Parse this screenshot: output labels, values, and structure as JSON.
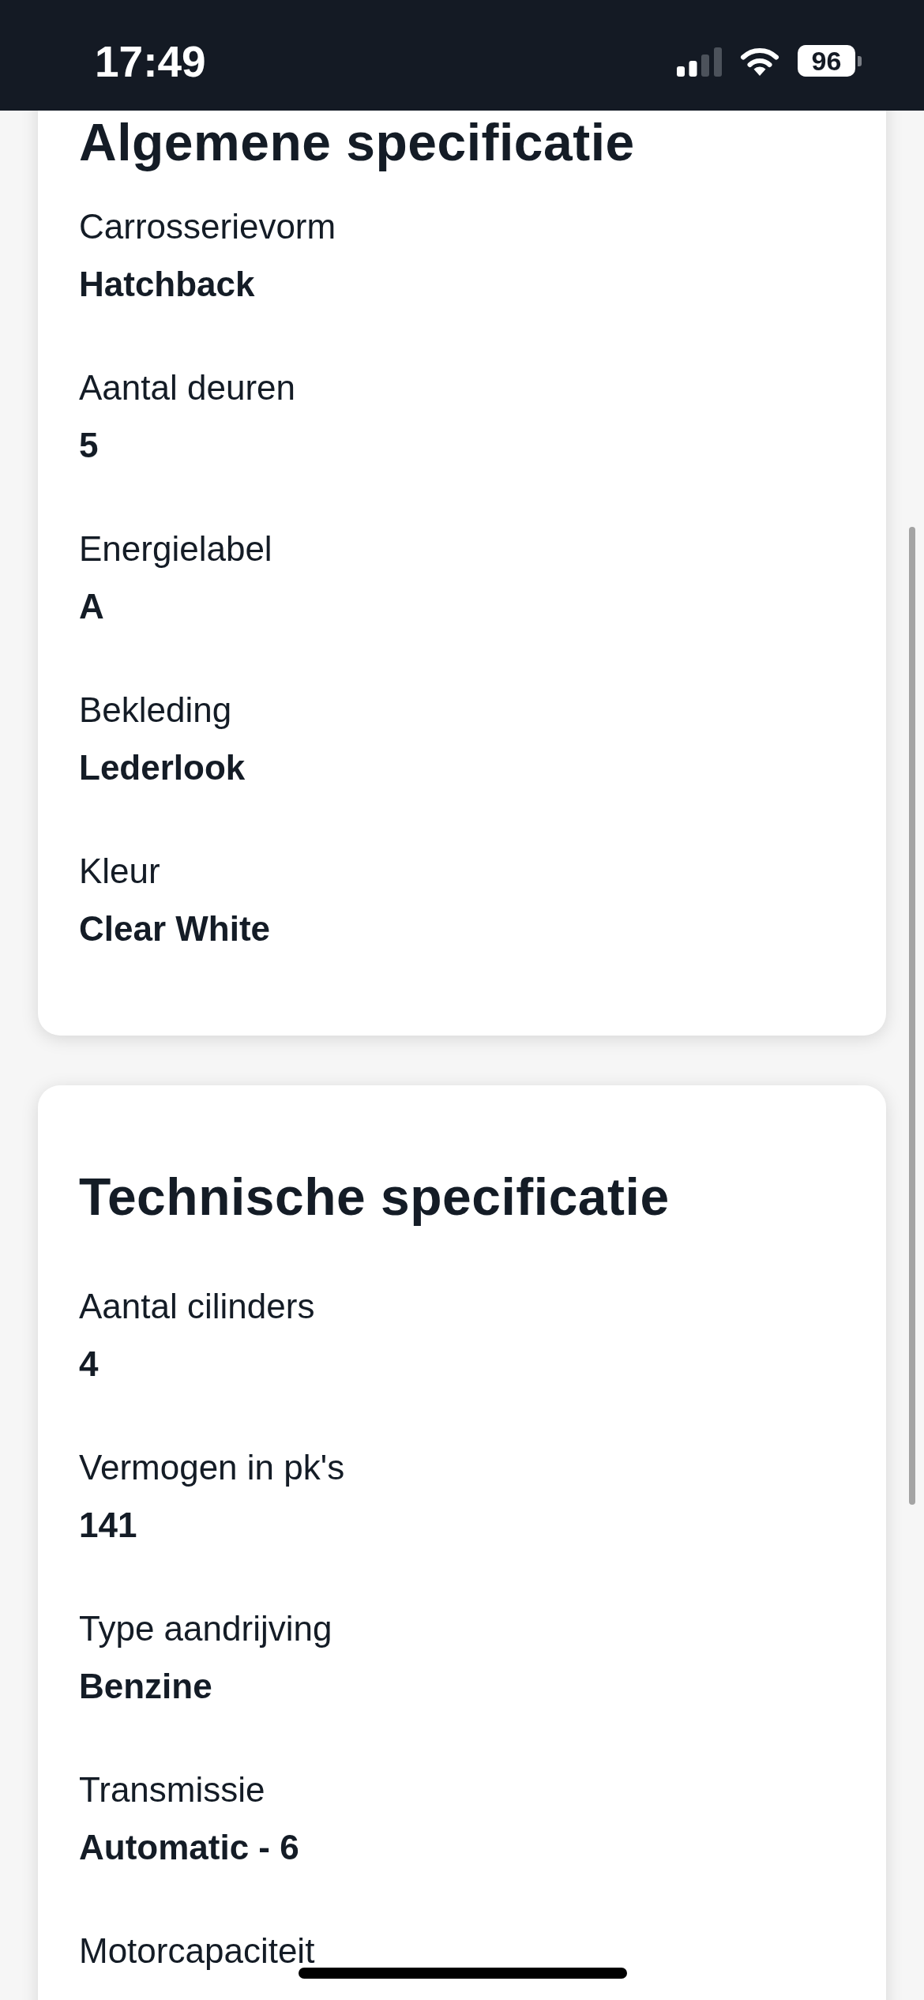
{
  "status_bar": {
    "time": "17:49",
    "battery": "96"
  },
  "sections": [
    {
      "title": "Algemene specificatie",
      "specs": [
        {
          "label": "Carrosserievorm",
          "value": "Hatchback"
        },
        {
          "label": "Aantal deuren",
          "value": "5"
        },
        {
          "label": "Energielabel",
          "value": "A"
        },
        {
          "label": "Bekleding",
          "value": "Lederlook"
        },
        {
          "label": "Kleur",
          "value": "Clear White"
        }
      ]
    },
    {
      "title": "Technische specificatie",
      "specs": [
        {
          "label": "Aantal cilinders",
          "value": "4"
        },
        {
          "label": "Vermogen in pk's",
          "value": "141"
        },
        {
          "label": "Type aandrijving",
          "value": "Benzine"
        },
        {
          "label": "Transmissie",
          "value": "Automatic - 6"
        },
        {
          "label": "Motorcapaciteit"
        }
      ]
    }
  ]
}
